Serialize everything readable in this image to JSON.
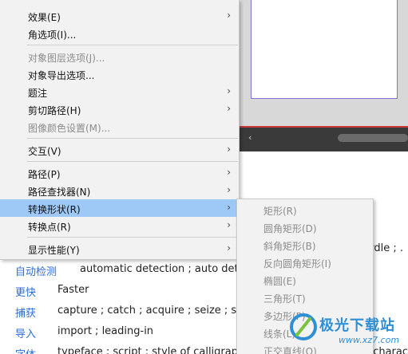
{
  "menu": {
    "items": [
      {
        "label": "效果(E)",
        "submenu": true,
        "disabled": false
      },
      {
        "label": "角选项(I)...",
        "submenu": false,
        "disabled": false
      },
      {
        "label": "对象图层选项(J)...",
        "submenu": false,
        "disabled": true
      },
      {
        "label": "对象导出选项...",
        "submenu": false,
        "disabled": false
      },
      {
        "label": "题注",
        "submenu": true,
        "disabled": false
      },
      {
        "label": "剪切路径(H)",
        "submenu": true,
        "disabled": false
      },
      {
        "label": "图像颜色设置(M)...",
        "submenu": false,
        "disabled": true
      },
      {
        "label": "交互(V)",
        "submenu": true,
        "disabled": false
      },
      {
        "label": "路径(P)",
        "submenu": true,
        "disabled": false
      },
      {
        "label": "路径查找器(N)",
        "submenu": true,
        "disabled": false
      },
      {
        "label": "转换形状(R)",
        "submenu": true,
        "disabled": false,
        "active": true
      },
      {
        "label": "转换点(R)",
        "submenu": true,
        "disabled": false
      },
      {
        "label": "显示性能(Y)",
        "submenu": true,
        "disabled": false
      }
    ],
    "arrow": "›"
  },
  "submenu": {
    "items": [
      {
        "label": "矩形(R)"
      },
      {
        "label": "圆角矩形(D)"
      },
      {
        "label": "斜角矩形(B)"
      },
      {
        "label": "反向圆角矩形(I)"
      },
      {
        "label": "椭圆(E)"
      },
      {
        "label": "三角形(T)"
      },
      {
        "label": "多边形(P)"
      },
      {
        "label": "线条(L)"
      },
      {
        "label": "正交直线(O)"
      }
    ]
  },
  "dictionary": {
    "rows": [
      {
        "term": "自动检测",
        "definition": "automatic detection ; auto detec"
      },
      {
        "term": "更快",
        "definition": "Faster"
      },
      {
        "term": "捕获",
        "definition": "capture ; catch ; acquire ; seize ; su"
      },
      {
        "term": "导入",
        "definition": "import ; leading-in"
      },
      {
        "term": "字体",
        "definition": "typeface ; script ; style of calligraphy"
      }
    ],
    "extra_right": "girdle ; .",
    "extra_right_bottom": "charac"
  },
  "scrollbar": {
    "left_arrow": "‹"
  },
  "watermark": {
    "text": "极光下载站",
    "url": "www.xz7.com"
  },
  "colors": {
    "menu_bg": "#f2f2f2",
    "active_bg": "#9ec9f7",
    "disabled_text": "#8c8c8c",
    "link_blue": "#2a6ed8",
    "artboard_border": "#8a6fd8"
  }
}
